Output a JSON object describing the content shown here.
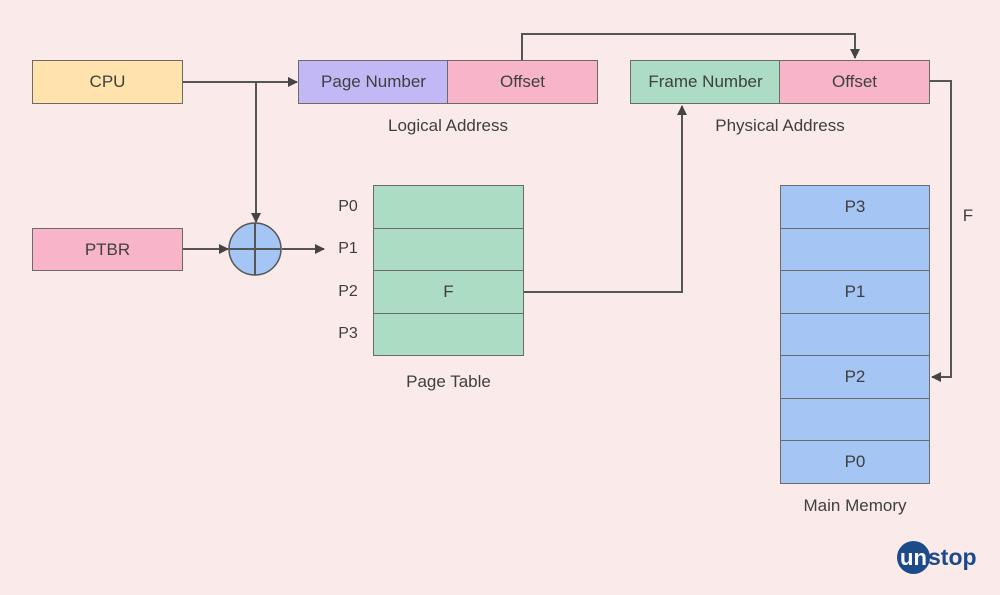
{
  "cpu": {
    "label": "CPU"
  },
  "ptbr": {
    "label": "PTBR"
  },
  "logical_address": {
    "page_number": "Page Number",
    "offset": "Offset",
    "caption": "Logical Address"
  },
  "physical_address": {
    "frame_number": "Frame Number",
    "offset": "Offset",
    "caption": "Physical Address"
  },
  "page_table": {
    "caption": "Page Table",
    "row_labels": [
      "P0",
      "P1",
      "P2",
      "P3"
    ],
    "rows": [
      "",
      "",
      "F",
      ""
    ]
  },
  "main_memory": {
    "caption": "Main Memory",
    "rows": [
      "P3",
      "",
      "P1",
      "",
      "P2",
      "",
      "P0"
    ]
  },
  "frame_label": "F",
  "logo": {
    "circle_text": "un",
    "rest_text": "stop"
  },
  "colors": {
    "background": "#fbeaea",
    "cpu": "#ffe2ac",
    "page_number": "#c3b8f6",
    "offset": "#f8b4c9",
    "frame_number": "#acdcc4",
    "page_table": "#acdcc4",
    "main_memory": "#a5c5f4",
    "adder": "#a5c5f4",
    "logo": "#1d4b8a"
  }
}
